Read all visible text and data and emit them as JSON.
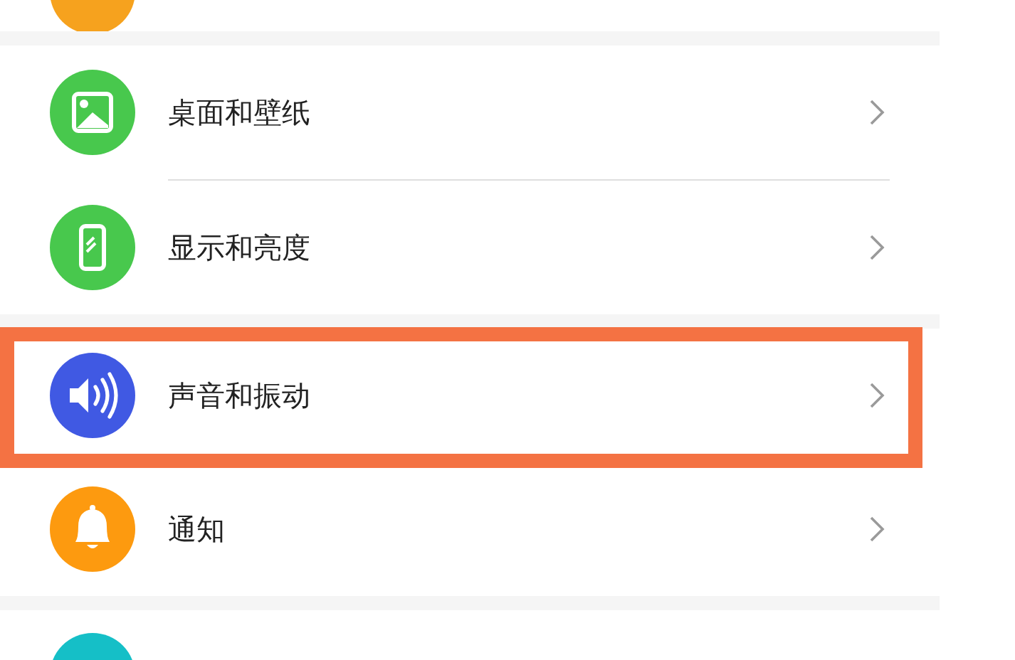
{
  "top_partial_item": {
    "color": "#f6a21e"
  },
  "groups": [
    {
      "items": [
        {
          "kind": "picture",
          "color": "#48c84d",
          "label": "桌面和壁纸",
          "highlighted": false
        },
        {
          "kind": "phone",
          "color": "#48c84d",
          "label": "显示和亮度",
          "highlighted": false
        }
      ]
    },
    {
      "items": [
        {
          "kind": "speaker",
          "color": "#4059e3",
          "label": "声音和振动",
          "highlighted": true
        },
        {
          "kind": "bell",
          "color": "#fd9a0f",
          "label": "通知",
          "highlighted": false
        }
      ]
    }
  ],
  "bottom_partial_item": {
    "color": "#15bfc7"
  }
}
